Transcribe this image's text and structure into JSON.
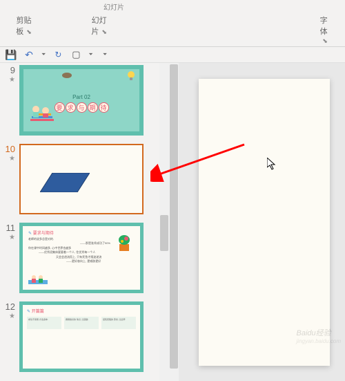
{
  "ribbon": {
    "groups": [
      "剪贴板",
      "幻灯片",
      "字体"
    ],
    "top_items": [
      "幻灯片"
    ]
  },
  "qat": {
    "save": "💾",
    "undo": "↶",
    "redo": "↻",
    "present": "▢",
    "dropdown": "⏷"
  },
  "thumbnails": [
    {
      "num": "9",
      "marker": "★"
    },
    {
      "num": "10",
      "marker": "★"
    },
    {
      "num": "11",
      "marker": "★"
    },
    {
      "num": "12",
      "marker": "★"
    }
  ],
  "slide9": {
    "part": "Part 02",
    "chars": [
      "要",
      "求",
      "与",
      "期",
      "待"
    ]
  },
  "slide11": {
    "title": "要求与期待",
    "line1": "老師的说多总是对的.",
    "line2": "——那是准肯成功了90%",
    "line3": "你在课中时间越多, 心中世界也越多",
    "line4": "——优秀班集体要要着一个人, 住优秀每一个人",
    "line5": "天会会途流而上, 只有死鱼才随波遂流",
    "line6": "——更好奋向上, 更威胁更好"
  },
  "slide12": {
    "title": "开篇篇",
    "col1": "成功不易偶 方法多种.",
    "col2": "拥堵版好的 情识, 比突破.",
    "col3": "经知费程的 意志, 比出甲"
  },
  "watermark": {
    "main": "Baidu经验",
    "sub": "jingyan.baidu.com"
  }
}
